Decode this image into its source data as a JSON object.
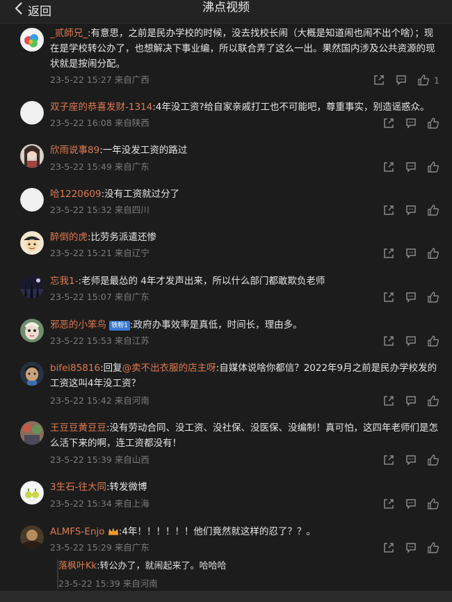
{
  "header": {
    "back_label": "返回",
    "title": "沸点视频"
  },
  "comments": [
    {
      "name": "_贰師兄_",
      "text": ":有意思，之前是民办学校的时候，没去找校长闹（大概是知道闹也闹不出个啥）；现在是学校转公办了，也想解决下事业编，所以联合弄了这么一出。果然国内涉及公共资源的现状就是按闹分配。",
      "meta": "23-5-22 15:27 来自广西",
      "likes": "1"
    },
    {
      "name": "双子座的恭喜发财-1314",
      "text": ":4年没工资?给自家亲戚打工也不可能吧，尊重事实，别造谣惑众。",
      "meta": "23-5-22 16:08 来自陕西"
    },
    {
      "name": "欣雨说事89",
      "text": ":一年没发工资的路过",
      "meta": "23-5-22 15:49 来自广东"
    },
    {
      "name": "哈1220609",
      "text": ":没有工资就过分了",
      "meta": "23-5-22 15:32 来自四川"
    },
    {
      "name": "醉倒的虎",
      "text": ":比劳务派遣还惨",
      "meta": "23-5-22 15:21 来自辽宁"
    },
    {
      "name": "忘我1-",
      "text": ":老师是最怂的 4年才发声出来，所以什么部门都敢欺负老师",
      "meta": "23-5-22 15:07 来自广东"
    },
    {
      "name": "邪恶的小笨鸟",
      "badge": "铁粉1",
      "text": ":政府办事效率是真低，时间长，理由多。",
      "meta": "23-5-22 15:53 来自江苏"
    },
    {
      "name": "bifei85816",
      "prefix": ":回复",
      "mention": "@卖不出衣服的店主呀",
      "text": ":自媒体说啥你都信？2022年9月之前是民办学校发的工资这叫4年没工资？",
      "meta": "23-5-22 15:42 来自河南"
    },
    {
      "name": "王豆豆黄豆豆",
      "text": ":没有劳动合同、没工资、没社保、没医保、没编制！真可怕，这四年老师们是怎么活下来的啊，连工资都没有！",
      "meta": "23-5-22 15:39 来自山西"
    },
    {
      "name": "3生石-往大同",
      "text": ":转发微博",
      "meta": "23-5-22 15:34 来自上海"
    },
    {
      "name": "ALMFS-Enjo",
      "text": ":4年！！！！！！他们竟然就这样的忍了？？。",
      "meta": "23-5-22 15:29 来自广东"
    }
  ],
  "reply": {
    "name": "落枫叶Kk",
    "text": ":转公办了，就闹起来了。哈哈哈",
    "meta": "23-5-22 15:39 来自河南"
  }
}
